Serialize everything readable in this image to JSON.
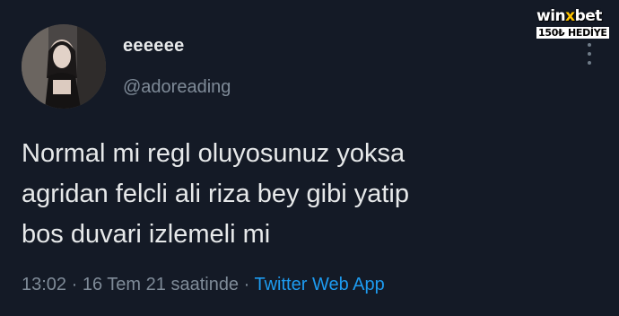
{
  "tweet": {
    "display_name": "eeeeee",
    "handle": "@adoreading",
    "text_lines": [
      "Normal mi regl oluyosunuz yoksa",
      "agridan felcli ali riza bey gibi yatip",
      "bos duvari izlemeli mi"
    ],
    "time": "13:02",
    "separator": "·",
    "date": "16 Tem 21 saatinde",
    "source": "Twitter Web App",
    "avatar_icon": "profile-photo",
    "more_icon": "more-options-icon"
  },
  "watermark": {
    "brand_part1": "win",
    "brand_x": "x",
    "brand_part2": "bet",
    "promo": "150₺ HEDİYE"
  },
  "colors": {
    "background": "#141a26",
    "text": "#e7e9ea",
    "secondary": "#7f8b98",
    "link": "#1d9bf0"
  }
}
